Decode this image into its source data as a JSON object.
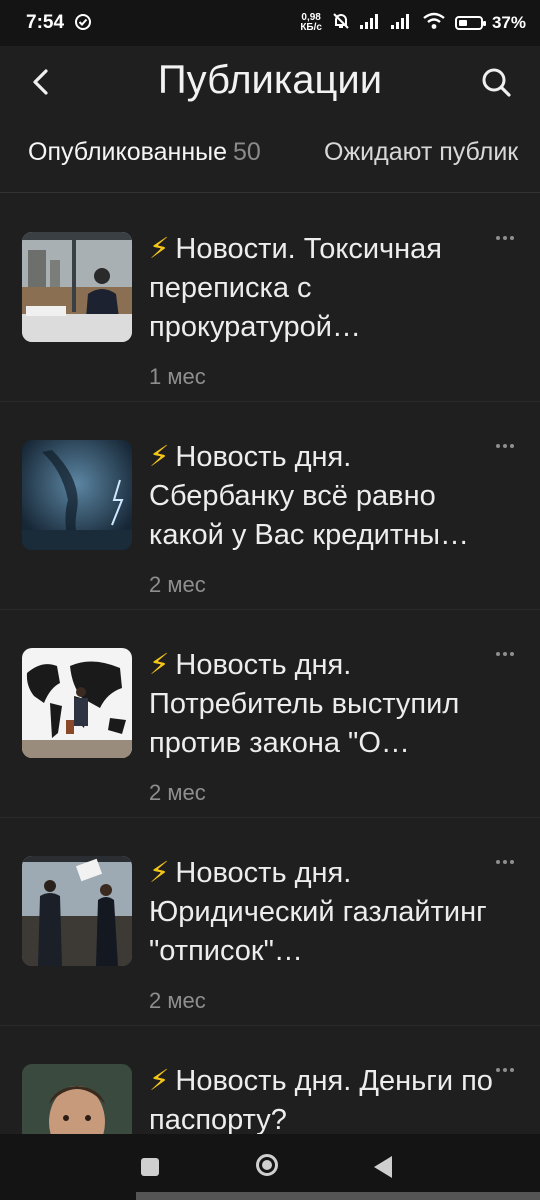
{
  "status": {
    "time": "7:54",
    "netspeed_value": "0,98",
    "netspeed_unit": "КБ/с",
    "battery": "37%",
    "battery_level": 0.37
  },
  "header": {
    "title": "Публикации"
  },
  "tabs": [
    {
      "label": "Опубликованные",
      "count": "50"
    },
    {
      "label": "Ожидают публик"
    }
  ],
  "posts": [
    {
      "title": "Новости. Токсичная переписка с прокуратурой…",
      "age": "1 мес"
    },
    {
      "title": "Новость дня. Сбербанку всё равно какой у Вас кредитны…",
      "age": "2 мес"
    },
    {
      "title": "Новость дня. Потребитель выступил против закона \"О…",
      "age": "2 мес"
    },
    {
      "title": "Новость дня. Юридический газлайтинг \"отписок\"…",
      "age": "2 мес"
    },
    {
      "title": "Новость дня. Деньги по паспорту?",
      "age": ""
    }
  ],
  "colors": {
    "background": "#1f1f1f",
    "accent_bolt": "#f5c518",
    "muted_text": "#8e8e8e"
  }
}
